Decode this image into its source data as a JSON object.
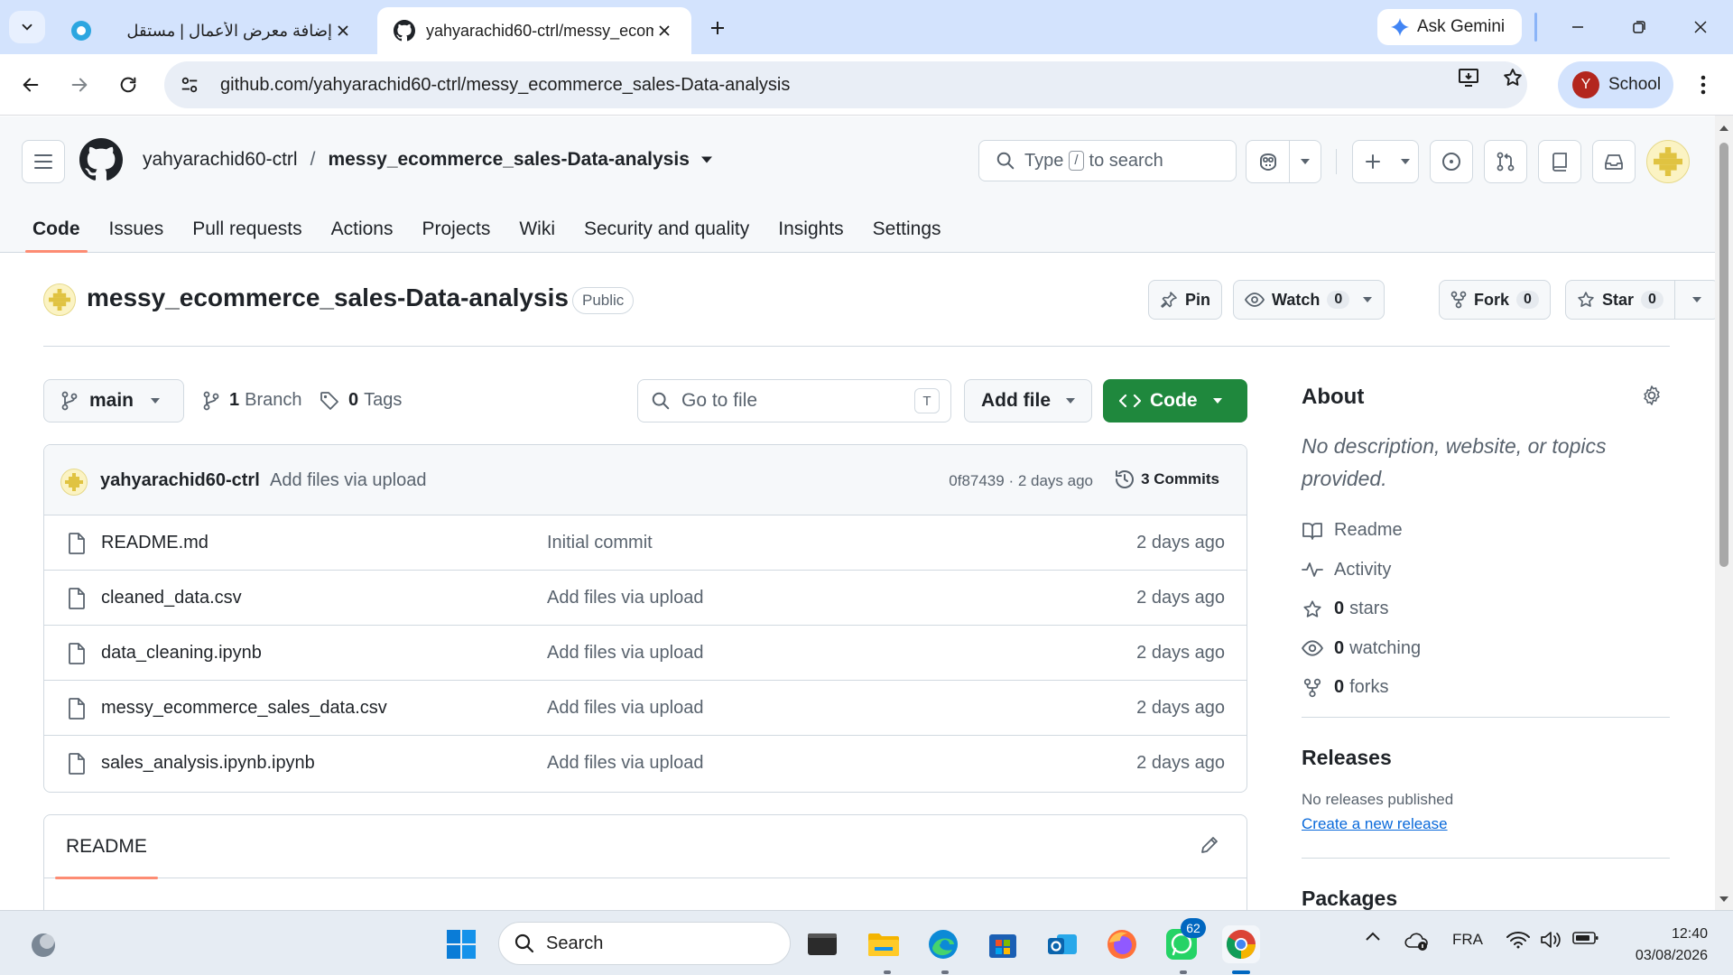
{
  "browser": {
    "tabs": [
      {
        "title": "إضافة معرض الأعمال | مستقل",
        "active": false
      },
      {
        "title": "yahyarachid60-ctrl/messy_ecom",
        "active": true
      }
    ],
    "gemini_label": "Ask Gemini",
    "url": "github.com/yahyarachid60-ctrl/messy_ecommerce_sales-Data-analysis",
    "profile_initial": "Y",
    "profile_label": "School"
  },
  "github": {
    "owner": "yahyarachid60-ctrl",
    "repo": "messy_ecommerce_sales-Data-analysis",
    "search": {
      "prefix": "Type",
      "key": "/",
      "suffix": "to search"
    },
    "tabs": [
      {
        "label": "Code",
        "selected": true
      },
      {
        "label": "Issues"
      },
      {
        "label": "Pull requests"
      },
      {
        "label": "Actions"
      },
      {
        "label": "Projects"
      },
      {
        "label": "Wiki"
      },
      {
        "label": "Security and quality"
      },
      {
        "label": "Insights"
      },
      {
        "label": "Settings"
      }
    ]
  },
  "repo_header": {
    "name": "messy_ecommerce_sales-Data-analysis",
    "visibility": "Public",
    "pin_label": "Pin",
    "watch_label": "Watch",
    "watch_count": "0",
    "fork_label": "Fork",
    "fork_count": "0",
    "star_label": "Star",
    "star_count": "0"
  },
  "controls": {
    "branch": "main",
    "branch_count": "1",
    "branch_label": "Branch",
    "tag_count": "0",
    "tag_label": "Tags",
    "goto_placeholder": "Go to file",
    "goto_key": "T",
    "add_file_label": "Add file",
    "code_label": "Code"
  },
  "latest_commit": {
    "author": "yahyarachid60-ctrl",
    "message": "Add files via upload",
    "sha_time": "0f87439 · 2 days ago",
    "commits_label": "3 Commits"
  },
  "files": [
    {
      "name": "README.md",
      "message": "Initial commit",
      "time": "2 days ago"
    },
    {
      "name": "cleaned_data.csv",
      "message": "Add files via upload",
      "time": "2 days ago"
    },
    {
      "name": "data_cleaning.ipynb",
      "message": "Add files via upload",
      "time": "2 days ago"
    },
    {
      "name": "messy_ecommerce_sales_data.csv",
      "message": "Add files via upload",
      "time": "2 days ago"
    },
    {
      "name": "sales_analysis.ipynb.ipynb",
      "message": "Add files via upload",
      "time": "2 days ago"
    }
  ],
  "readme": {
    "tab_label": "README"
  },
  "about": {
    "title": "About",
    "description": "No description, website, or topics provided.",
    "readme_label": "Readme",
    "activity_label": "Activity",
    "stars_count": "0",
    "stars_label": "stars",
    "watching_count": "0",
    "watching_label": "watching",
    "forks_count": "0",
    "forks_label": "forks"
  },
  "releases": {
    "title": "Releases",
    "none_text": "No releases published",
    "create_link": "Create a new release"
  },
  "packages": {
    "title": "Packages"
  },
  "taskbar": {
    "search_label": "Search",
    "whatsapp_badge": "62",
    "language": "FRA",
    "time": "12:40",
    "date": "03/08/2026"
  },
  "colors": {
    "accent_green": "#1f883d",
    "tab_underline": "#fd8c73",
    "link_blue": "#0969da",
    "chrome_tabbar": "#d3e3fd"
  }
}
